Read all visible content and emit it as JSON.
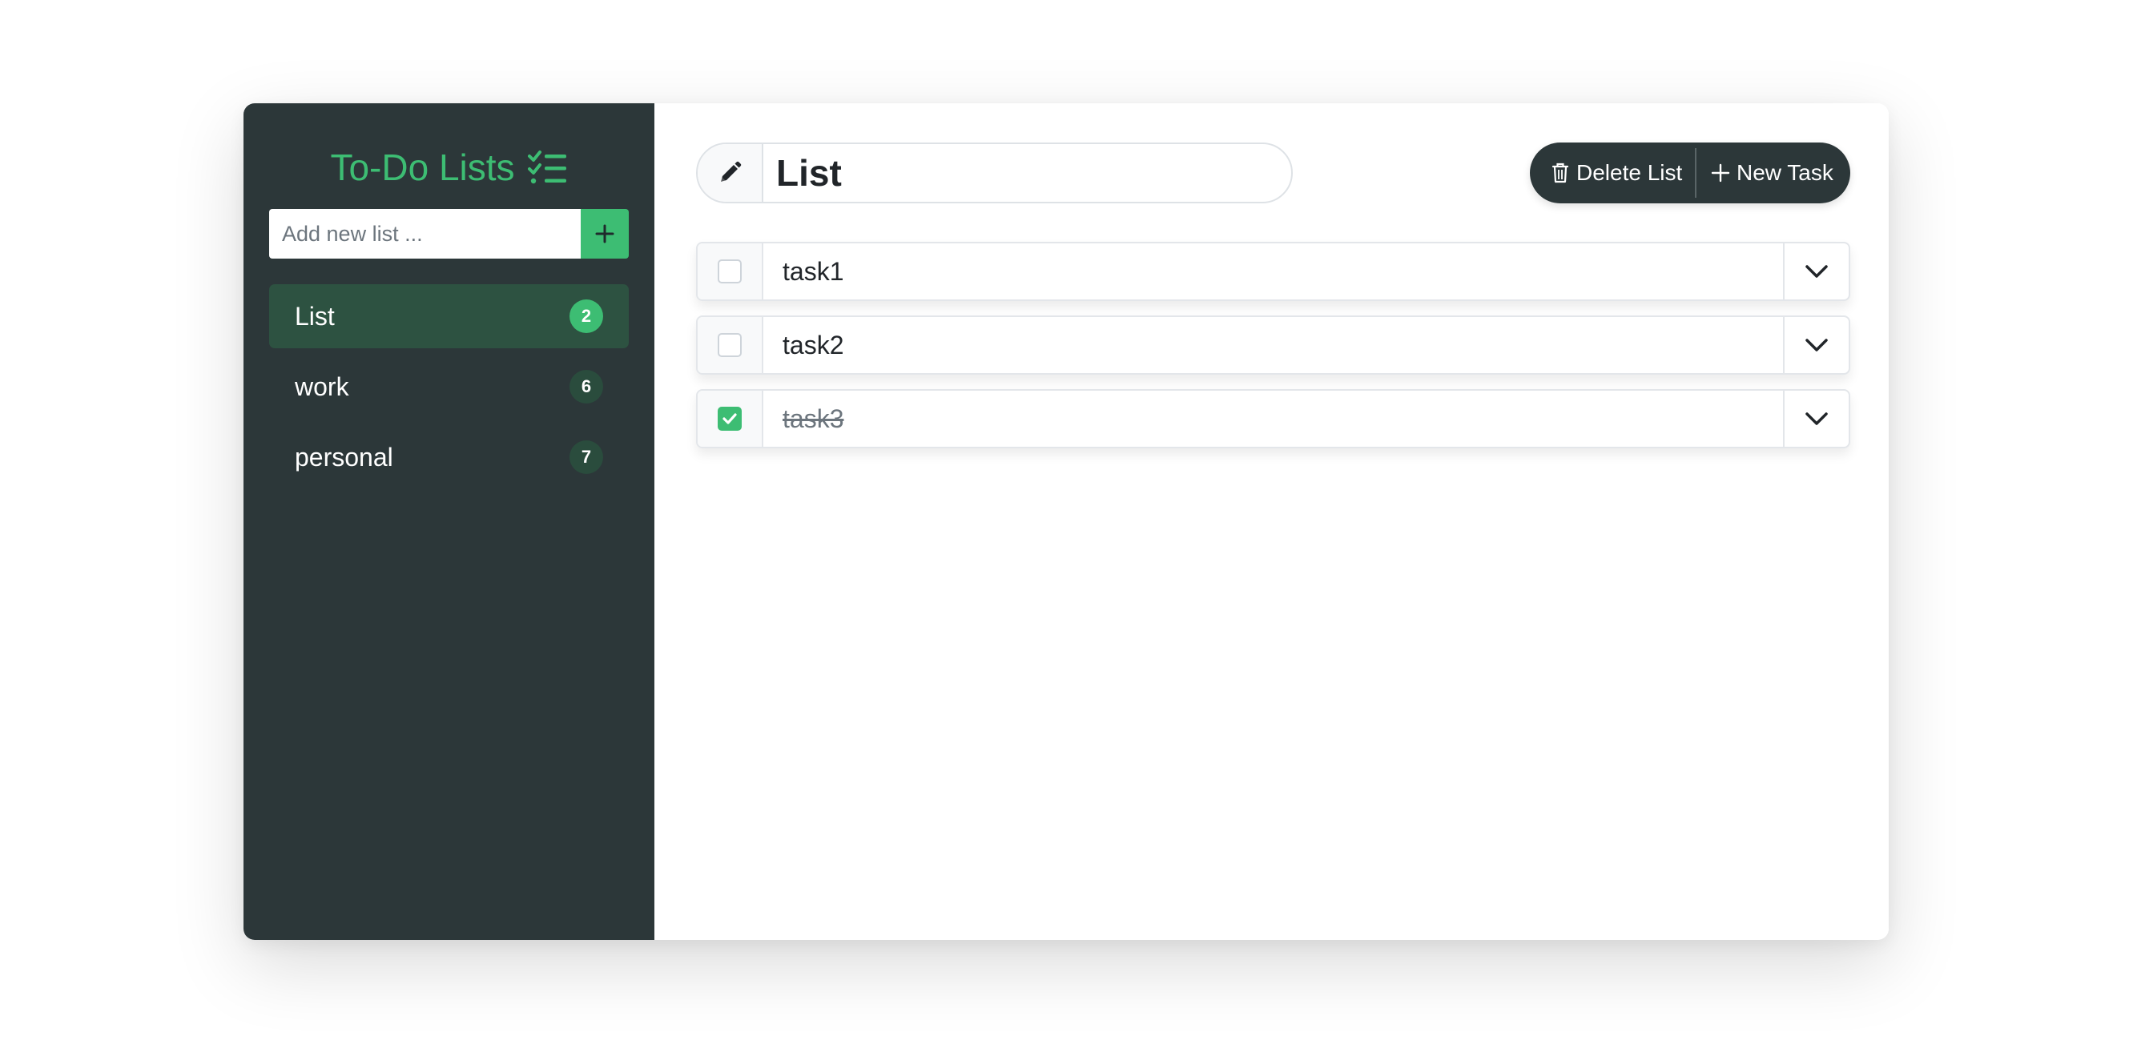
{
  "sidebar": {
    "title": "To-Do Lists",
    "title_icon": "list-check-icon",
    "add_placeholder": "Add new list ...",
    "add_button_icon": "plus-icon",
    "lists": [
      {
        "name": "List",
        "count": "2",
        "active": true
      },
      {
        "name": "work",
        "count": "6",
        "active": false
      },
      {
        "name": "personal",
        "count": "7",
        "active": false
      }
    ]
  },
  "main": {
    "list_title": "List",
    "edit_icon": "pencil-icon",
    "delete_label": "Delete List",
    "new_task_label": "New Task",
    "tasks": [
      {
        "name": "task1",
        "done": false
      },
      {
        "name": "task2",
        "done": false
      },
      {
        "name": "task3",
        "done": true
      }
    ]
  },
  "colors": {
    "accent": "#3dbd73",
    "sidebar_bg": "#2c3739",
    "active_item_bg": "#2d5241"
  }
}
